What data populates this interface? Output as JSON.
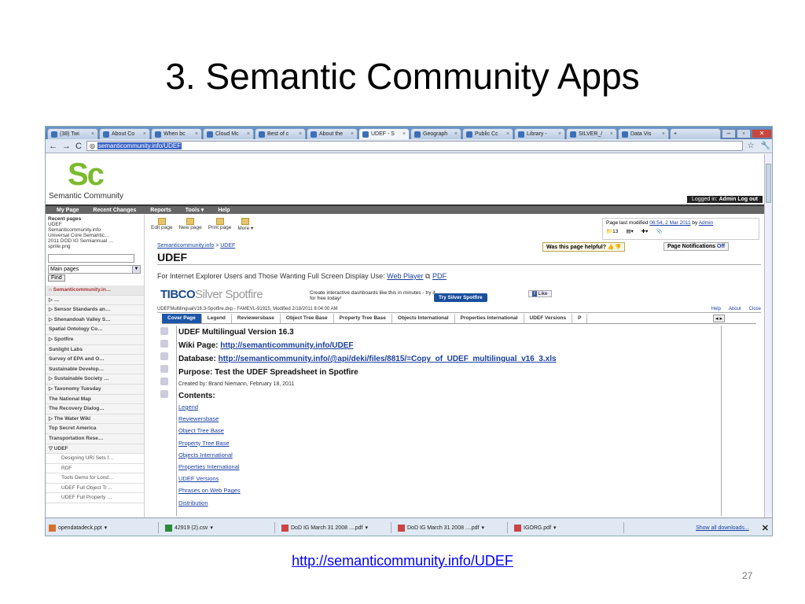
{
  "slide": {
    "title": "3. Semantic Community Apps",
    "footer_link": "http://semanticommunity.info/UDEF",
    "page_number": "27"
  },
  "browser": {
    "tabs": [
      {
        "label": "(38) Twi"
      },
      {
        "label": "About Co"
      },
      {
        "label": "When bc"
      },
      {
        "label": "Cloud Mc"
      },
      {
        "label": "Best of c"
      },
      {
        "label": "About the"
      },
      {
        "label": "UDEF - S",
        "active": true
      },
      {
        "label": "Geograph"
      },
      {
        "label": "Public Cc"
      },
      {
        "label": "Library -"
      },
      {
        "label": "SILVER_/"
      },
      {
        "label": "Data Vis"
      }
    ],
    "url": "semanticommunity.info/UDEF"
  },
  "site": {
    "logo_text": "Semantic Community",
    "logged_in_label": "Logged in:",
    "logged_in_user": "Admin",
    "logout": "Log out",
    "menu": [
      "My Page",
      "Recent Changes",
      "Reports",
      "Tools ▾",
      "Help"
    ]
  },
  "left": {
    "recent_heading": "Recent pages",
    "recent": [
      "UDEF",
      "Semanticommunity.info",
      "Universal Core Semantic…",
      "2011 DOD IG Semiannual …",
      "sprite.png"
    ],
    "select_value": "Main pages",
    "find_label": "Find",
    "tree": [
      {
        "label": "⌂ Semanticommunity.in…",
        "type": "top"
      },
      {
        "label": "▷ …",
        "type": "item"
      },
      {
        "label": "▷ Sensor Standards an…",
        "type": "item"
      },
      {
        "label": "▷ Shenandoah Valley S…",
        "type": "item"
      },
      {
        "label": "Spatial Ontology Co…",
        "type": "item"
      },
      {
        "label": "▷ Spotfire",
        "type": "item"
      },
      {
        "label": "Sunlight Labs",
        "type": "item"
      },
      {
        "label": "Survey of EPA and O…",
        "type": "item"
      },
      {
        "label": "Sustainable Develop…",
        "type": "item"
      },
      {
        "label": "▷ Sustainable Society …",
        "type": "item"
      },
      {
        "label": "▷ Taxonomy Tuesday",
        "type": "item"
      },
      {
        "label": "The National Map",
        "type": "item"
      },
      {
        "label": "The Recovery Dialog…",
        "type": "item"
      },
      {
        "label": "▷ The Water Wiki",
        "type": "item"
      },
      {
        "label": "Top Secret America",
        "type": "item"
      },
      {
        "label": "Transportation Rese…",
        "type": "item"
      },
      {
        "label": "▽ UDEF",
        "type": "item"
      },
      {
        "label": "Designing URI Sets f…",
        "type": "sub"
      },
      {
        "label": "RDF",
        "type": "sub"
      },
      {
        "label": "Tools Demo for Lond…",
        "type": "sub"
      },
      {
        "label": "UDEF Full Object Tr…",
        "type": "sub"
      },
      {
        "label": "UDEF Full Property …",
        "type": "sub"
      }
    ]
  },
  "page": {
    "tools": [
      "Edit page",
      "New page",
      "Print page",
      "More ▾"
    ],
    "last_modified_prefix": "Page last modified",
    "last_modified_date": "06:54, 2 Mar 2011",
    "last_modified_by": "by",
    "last_modified_user": "Admin",
    "counts": [
      "13"
    ],
    "breadcrumb_root": "Semanticommunity.info",
    "breadcrumb_sep": ">",
    "breadcrumb_leaf": "UDEF",
    "title": "UDEF",
    "helpful": "Was this page helpful?",
    "notifications_label": "Page Notifications",
    "notifications_value": "Off",
    "ie_text": "For Internet Explorer Users and Those Wanting Full Screen Display Use:",
    "web_player": "Web Player",
    "pdf": "PDF"
  },
  "spotfire": {
    "tibco": "TIBCO",
    "silver": "Silver",
    "spotfire": "Spotfire",
    "create_text": "Create interactive dashboards like this in minutes - try it for free today!",
    "try_button": "Try Silver Spotfire",
    "like": "Like",
    "file_info": "UDEFMultilingualV16.3-Spotfire.dxp - FAMEVL-91915, Modified 2/18/2011 8:04:00 AM",
    "help": "Help",
    "about": "About",
    "close": "Close",
    "tabs": [
      "Cover Page",
      "Legend",
      "Reviewersbase",
      "Object Tree Base",
      "Property Tree Base",
      "Objects International",
      "Properties International",
      "UDEF Versions",
      "P"
    ],
    "heading": "UDEF Multilingual Version 16.3",
    "wiki_label": "Wiki Page:",
    "wiki_url": "http://semanticommunity.info/UDEF",
    "db_label": "Database:",
    "db_url": "http://semanticommunity.info/@api/deki/files/8815/=Copy_of_UDEF_multilingual_v16_3.xls",
    "purpose": "Purpose: Test the UDEF Spreadsheet in Spotfire",
    "created": "Created by: Brand Niemann, February 18, 2011",
    "contents": "Contents:",
    "links": [
      "Legend",
      "Reviewersbase",
      "Object Tree Base",
      "Property Tree Base",
      "Objects International",
      "Properties International",
      "UDEF Versions",
      "Phrases on Web Pages",
      "Distribution"
    ]
  },
  "downloads": {
    "items": [
      "opendatadeck.ppt",
      "42919 (2).csv",
      "DoD IG March 31 2008 ....pdf",
      "DoD IG March 31 2008 ....pdf",
      "IGORG.pdf"
    ],
    "show_all": "Show all downloads..."
  }
}
